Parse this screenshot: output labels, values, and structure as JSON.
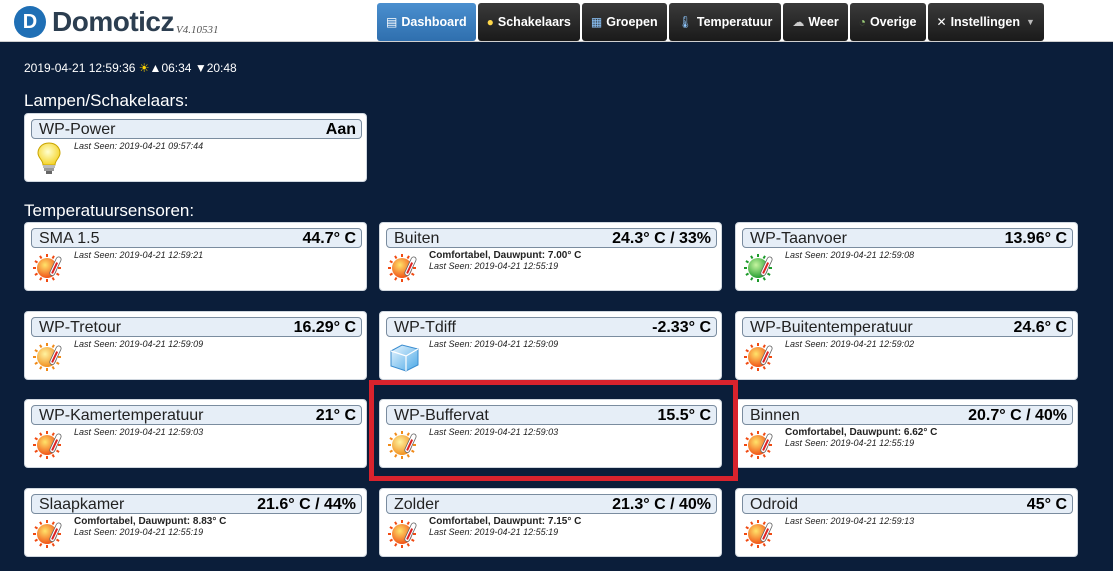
{
  "app": {
    "name": "Domoticz",
    "version": "V4.10531"
  },
  "nav": [
    {
      "label": "Dashboard",
      "icon": "dashboard-icon",
      "active": true
    },
    {
      "label": "Schakelaars",
      "icon": "lightbulb-icon",
      "active": false
    },
    {
      "label": "Groepen",
      "icon": "groups-icon",
      "active": false
    },
    {
      "label": "Temperatuur",
      "icon": "thermometer-icon",
      "active": false
    },
    {
      "label": "Weer",
      "icon": "weather-icon",
      "active": false
    },
    {
      "label": "Overige",
      "icon": "utility-icon",
      "active": false
    },
    {
      "label": "Instellingen",
      "icon": "tools-icon",
      "active": false
    }
  ],
  "status": {
    "datetime": "2019-04-21 12:59:36",
    "sunrise": "06:34",
    "sunset": "20:48"
  },
  "sections": {
    "switches_title": "Lampen/Schakelaars:",
    "temps_title": "Temperatuursensoren:"
  },
  "switches": [
    {
      "name": "WP-Power",
      "value": "Aan",
      "last_seen": "Last Seen: 2019-04-21 09:57:44"
    }
  ],
  "temps": [
    {
      "name": "SMA 1.5",
      "value": "44.7° C",
      "extra": "",
      "last_seen": "Last Seen: 2019-04-21 12:59:21",
      "icon": "hot"
    },
    {
      "name": "Buiten",
      "value": "24.3° C / 33%",
      "extra": "Comfortabel, Dauwpunt: 7.00° C",
      "last_seen": "Last Seen: 2019-04-21 12:55:19",
      "icon": "hot"
    },
    {
      "name": "WP-Taanvoer",
      "value": "13.96° C",
      "extra": "",
      "last_seen": "Last Seen: 2019-04-21 12:59:08",
      "icon": "green"
    },
    {
      "name": "WP-Tretour",
      "value": "16.29° C",
      "extra": "",
      "last_seen": "Last Seen: 2019-04-21 12:59:09",
      "icon": "warm"
    },
    {
      "name": "WP-Tdiff",
      "value": "-2.33° C",
      "extra": "",
      "last_seen": "Last Seen: 2019-04-21 12:59:09",
      "icon": "ice"
    },
    {
      "name": "WP-Buitentemperatuur",
      "value": "24.6° C",
      "extra": "",
      "last_seen": "Last Seen: 2019-04-21 12:59:02",
      "icon": "hot"
    },
    {
      "name": "WP-Kamertemperatuur",
      "value": "21° C",
      "extra": "",
      "last_seen": "Last Seen: 2019-04-21 12:59:03",
      "icon": "hot"
    },
    {
      "name": "WP-Buffervat",
      "value": "15.5° C",
      "extra": "",
      "last_seen": "Last Seen: 2019-04-21 12:59:03",
      "icon": "warm"
    },
    {
      "name": "Binnen",
      "value": "20.7° C / 40%",
      "extra": "Comfortabel, Dauwpunt: 6.62° C",
      "last_seen": "Last Seen: 2019-04-21 12:55:19",
      "icon": "hot"
    },
    {
      "name": "Slaapkamer",
      "value": "21.6° C / 44%",
      "extra": "Comfortabel, Dauwpunt: 8.83° C",
      "last_seen": "Last Seen: 2019-04-21 12:55:19",
      "icon": "hot"
    },
    {
      "name": "Zolder",
      "value": "21.3° C / 40%",
      "extra": "Comfortabel, Dauwpunt: 7.15° C",
      "last_seen": "Last Seen: 2019-04-21 12:55:19",
      "icon": "hot"
    },
    {
      "name": "Odroid",
      "value": "45° C",
      "extra": "",
      "last_seen": "Last Seen: 2019-04-21 12:59:13",
      "icon": "hot"
    }
  ],
  "colors": {
    "background": "#0b1e3a",
    "nav_active": "#3a7fc0",
    "highlight": "#d9232d"
  }
}
